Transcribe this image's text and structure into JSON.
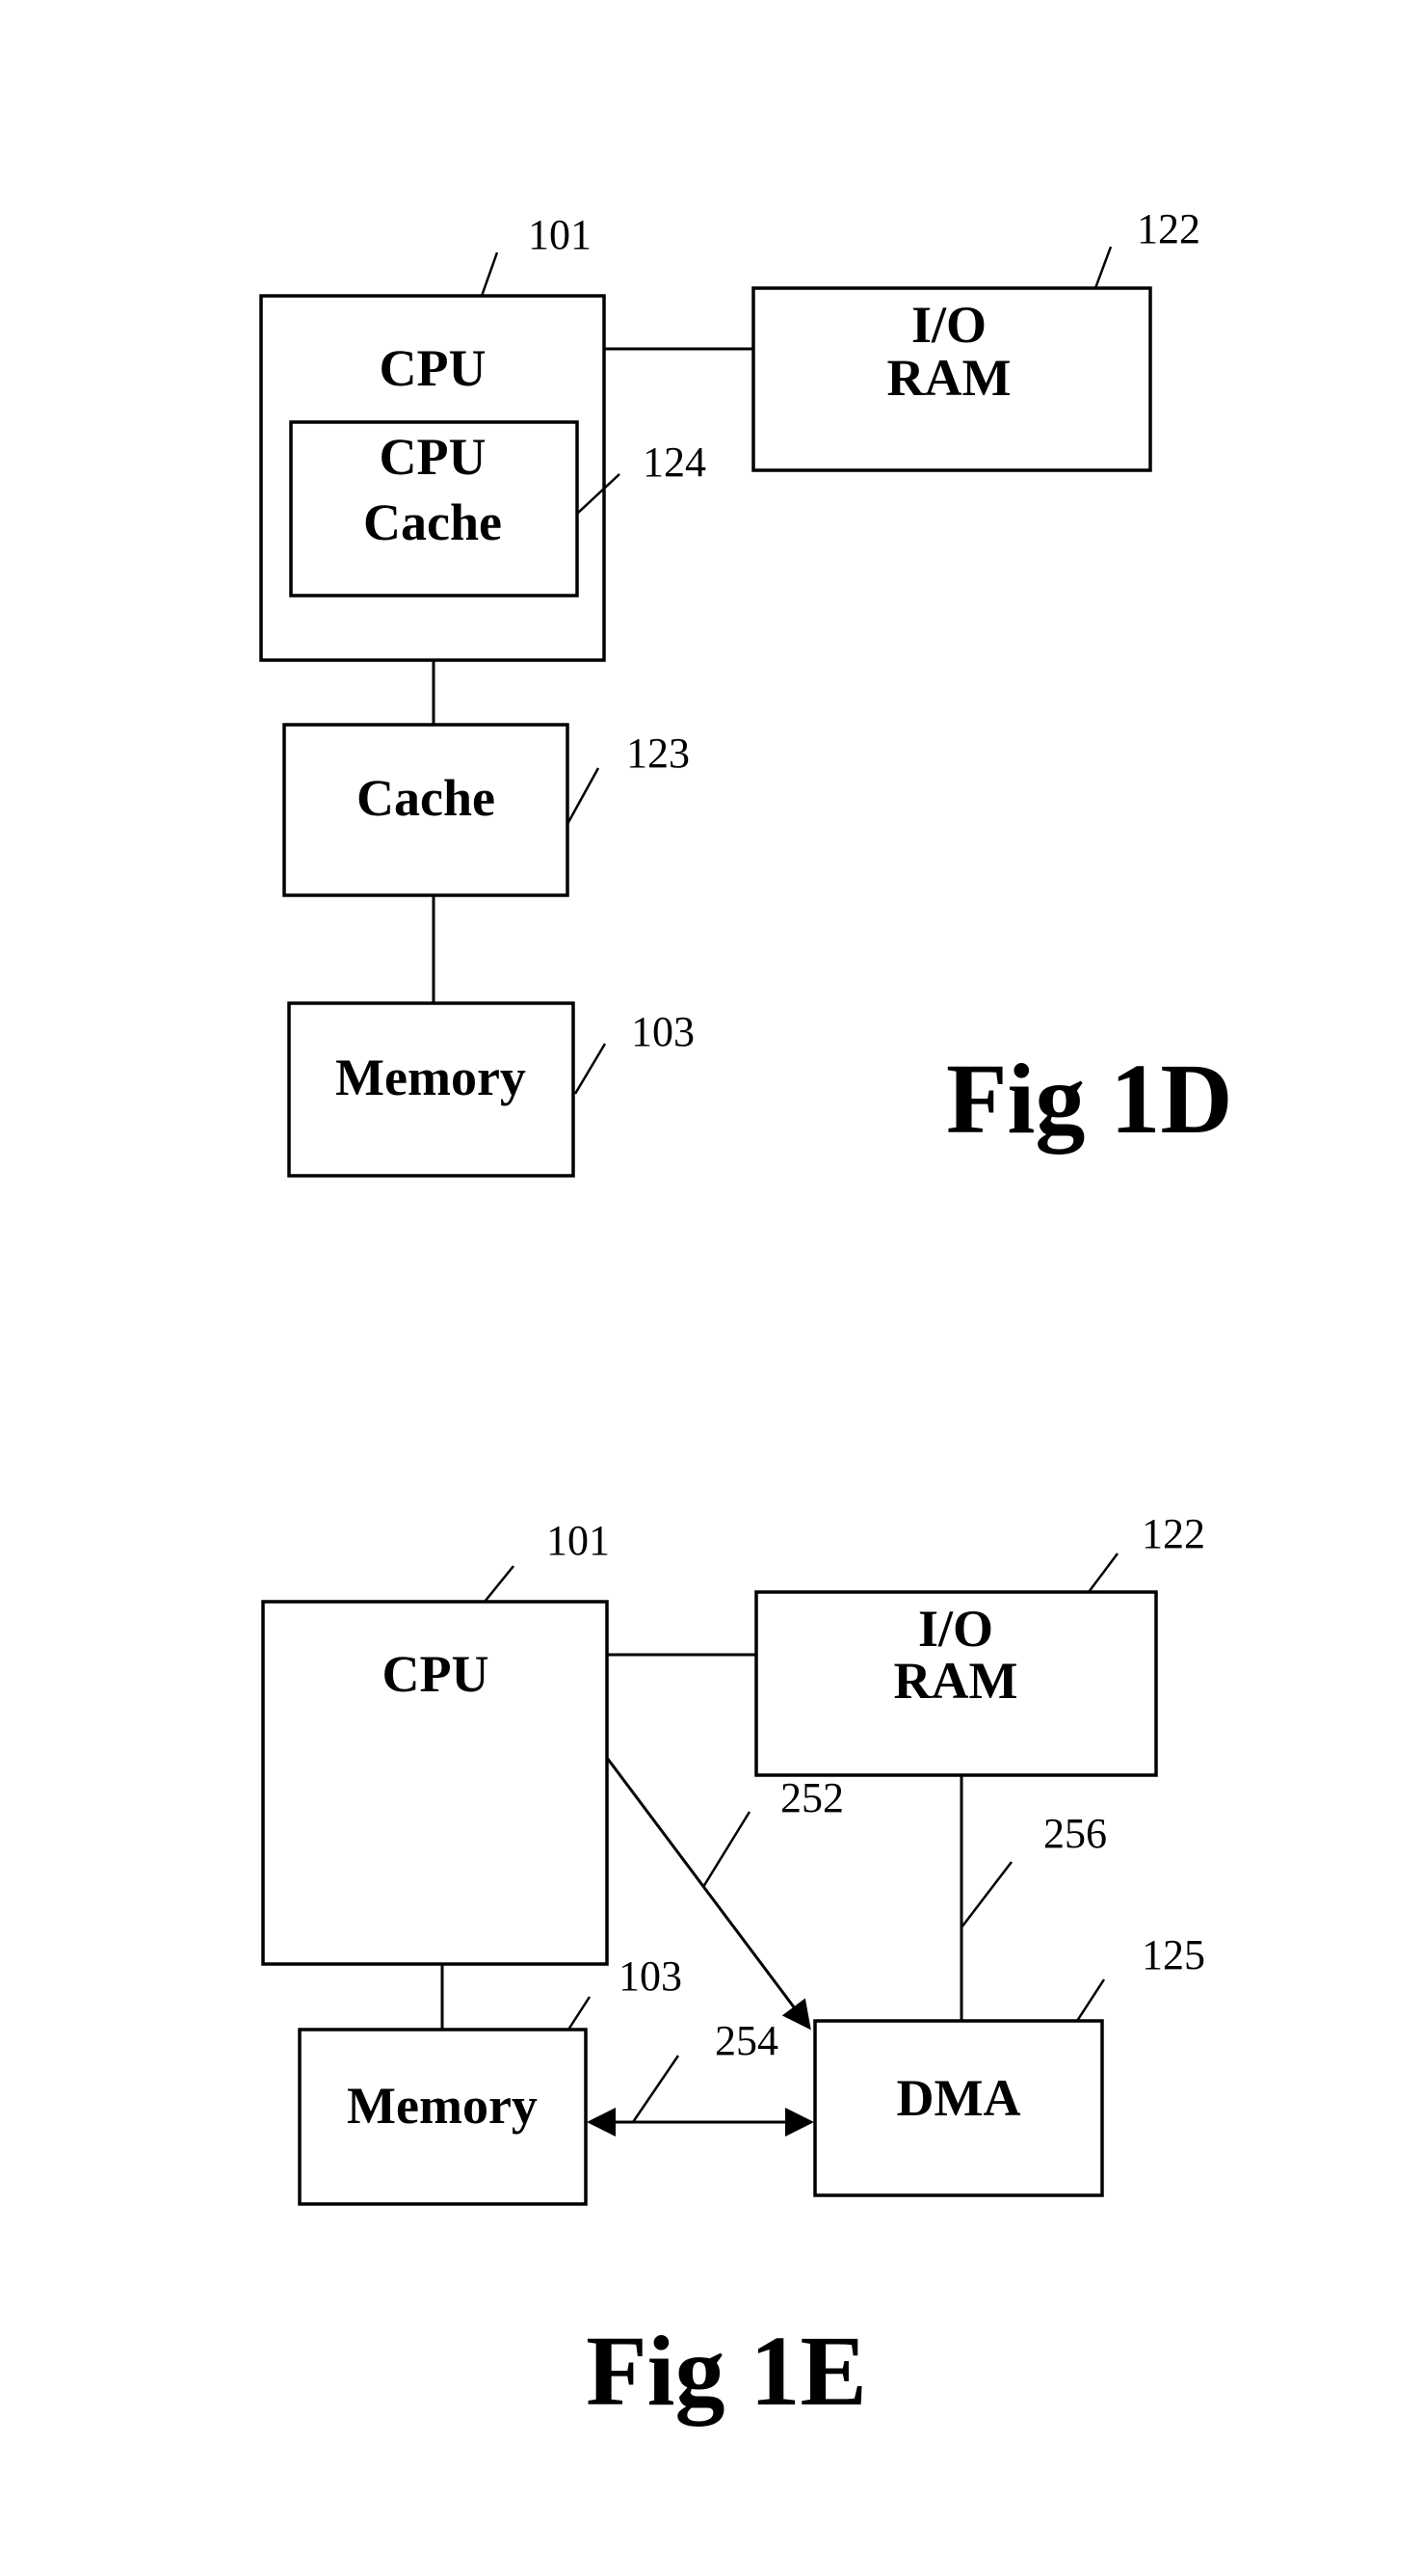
{
  "figures": [
    {
      "title": "Fig 1D",
      "blocks": {
        "cpu": {
          "label": "CPU",
          "ref": "101"
        },
        "cpu_cache": {
          "label_line1": "CPU",
          "label_line2": "Cache",
          "ref": "124"
        },
        "io_ram": {
          "label_line1": "I/O",
          "label_line2": "RAM",
          "ref": "122"
        },
        "cache": {
          "label": "Cache",
          "ref": "123"
        },
        "memory": {
          "label": "Memory",
          "ref": "103"
        }
      },
      "connections": [
        {
          "from": "CPU",
          "to": "I/O RAM"
        },
        {
          "from": "CPU",
          "to": "Cache"
        },
        {
          "from": "Cache",
          "to": "Memory"
        }
      ]
    },
    {
      "title": "Fig 1E",
      "blocks": {
        "cpu": {
          "label": "CPU",
          "ref": "101"
        },
        "io_ram": {
          "label_line1": "I/O",
          "label_line2": "RAM",
          "ref": "122"
        },
        "memory": {
          "label": "Memory",
          "ref": "103"
        },
        "dma": {
          "label": "DMA",
          "ref": "125"
        }
      },
      "connections": [
        {
          "from": "CPU",
          "to": "I/O RAM"
        },
        {
          "from": "CPU",
          "to": "Memory"
        },
        {
          "from": "CPU",
          "to": "DMA",
          "ref": "252",
          "arrow": "to"
        },
        {
          "from": "Memory",
          "to": "DMA",
          "ref": "254",
          "arrow": "both"
        },
        {
          "from": "I/O RAM",
          "to": "DMA",
          "ref": "256"
        }
      ]
    }
  ]
}
